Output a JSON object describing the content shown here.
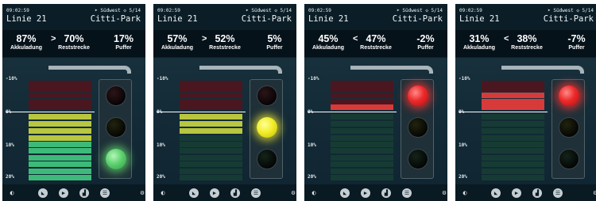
{
  "colors": {
    "background": "#0b1e28",
    "stats_background": "#06121a",
    "red_on": "#ec2a2a",
    "yellow_on": "#f2ee2a",
    "green_on": "#5ed170"
  },
  "scale_labels": [
    "-10%",
    "0%",
    "10%",
    "20%"
  ],
  "toolbar_icons": [
    "contrast-icon",
    "map-icon",
    "video-icon",
    "chart-icon",
    "list-icon",
    "settings-icon"
  ],
  "screens": [
    {
      "header": {
        "time": "09:02:59",
        "direction": "Südwest",
        "stop_progress": "5/14",
        "route": "Linie 21",
        "stop": "Citti-Park"
      },
      "stats": {
        "battery_value": "87%",
        "battery_label": "Akkuladung",
        "comparator": ">",
        "distance_value": "70%",
        "distance_label": "Reststrecke",
        "buffer_value": "17%",
        "buffer_label": "Puffer"
      },
      "active_light": "green",
      "bars": {
        "above_zero_active": 0,
        "below_zero": [
          "yellow",
          "yellow",
          "yellow",
          "yellow",
          "green",
          "green",
          "green",
          "green",
          "green",
          "green"
        ]
      }
    },
    {
      "header": {
        "time": "09:02:59",
        "direction": "Südwest",
        "stop_progress": "5/14",
        "route": "Linie 21",
        "stop": "Citti-Park"
      },
      "stats": {
        "battery_value": "57%",
        "battery_label": "Akkuladung",
        "comparator": ">",
        "distance_value": "52%",
        "distance_label": "Reststrecke",
        "buffer_value": "5%",
        "buffer_label": "Puffer"
      },
      "active_light": "yellow",
      "bars": {
        "above_zero_active": 0,
        "below_zero": [
          "yellow",
          "yellow",
          "yellow",
          "dim",
          "dim",
          "dim",
          "dim",
          "dim",
          "dim",
          "dim"
        ]
      }
    },
    {
      "header": {
        "time": "09:02:59",
        "direction": "Südwest",
        "stop_progress": "5/14",
        "route": "Linie 21",
        "stop": "Citti-Park"
      },
      "stats": {
        "battery_value": "45%",
        "battery_label": "Akkuladung",
        "comparator": "<",
        "distance_value": "47%",
        "distance_label": "Reststrecke",
        "buffer_value": "-2%",
        "buffer_label": "Puffer"
      },
      "active_light": "red",
      "bars": {
        "above_zero_active": 1,
        "below_zero": [
          "dim",
          "dim",
          "dim",
          "dim",
          "dim",
          "dim",
          "dim",
          "dim",
          "dim",
          "dim"
        ]
      }
    },
    {
      "header": {
        "time": "09:02:59",
        "direction": "Südwest",
        "stop_progress": "5/14",
        "route": "Linie 21",
        "stop": "Citti-Park"
      },
      "stats": {
        "battery_value": "31%",
        "battery_label": "Akkuladung",
        "comparator": "<",
        "distance_value": "38%",
        "distance_label": "Reststrecke",
        "buffer_value": "-7%",
        "buffer_label": "Puffer"
      },
      "active_light": "red",
      "bars": {
        "above_zero_active": 3,
        "below_zero": [
          "dim",
          "dim",
          "dim",
          "dim",
          "dim",
          "dim",
          "dim",
          "dim",
          "dim",
          "dim"
        ]
      }
    }
  ]
}
